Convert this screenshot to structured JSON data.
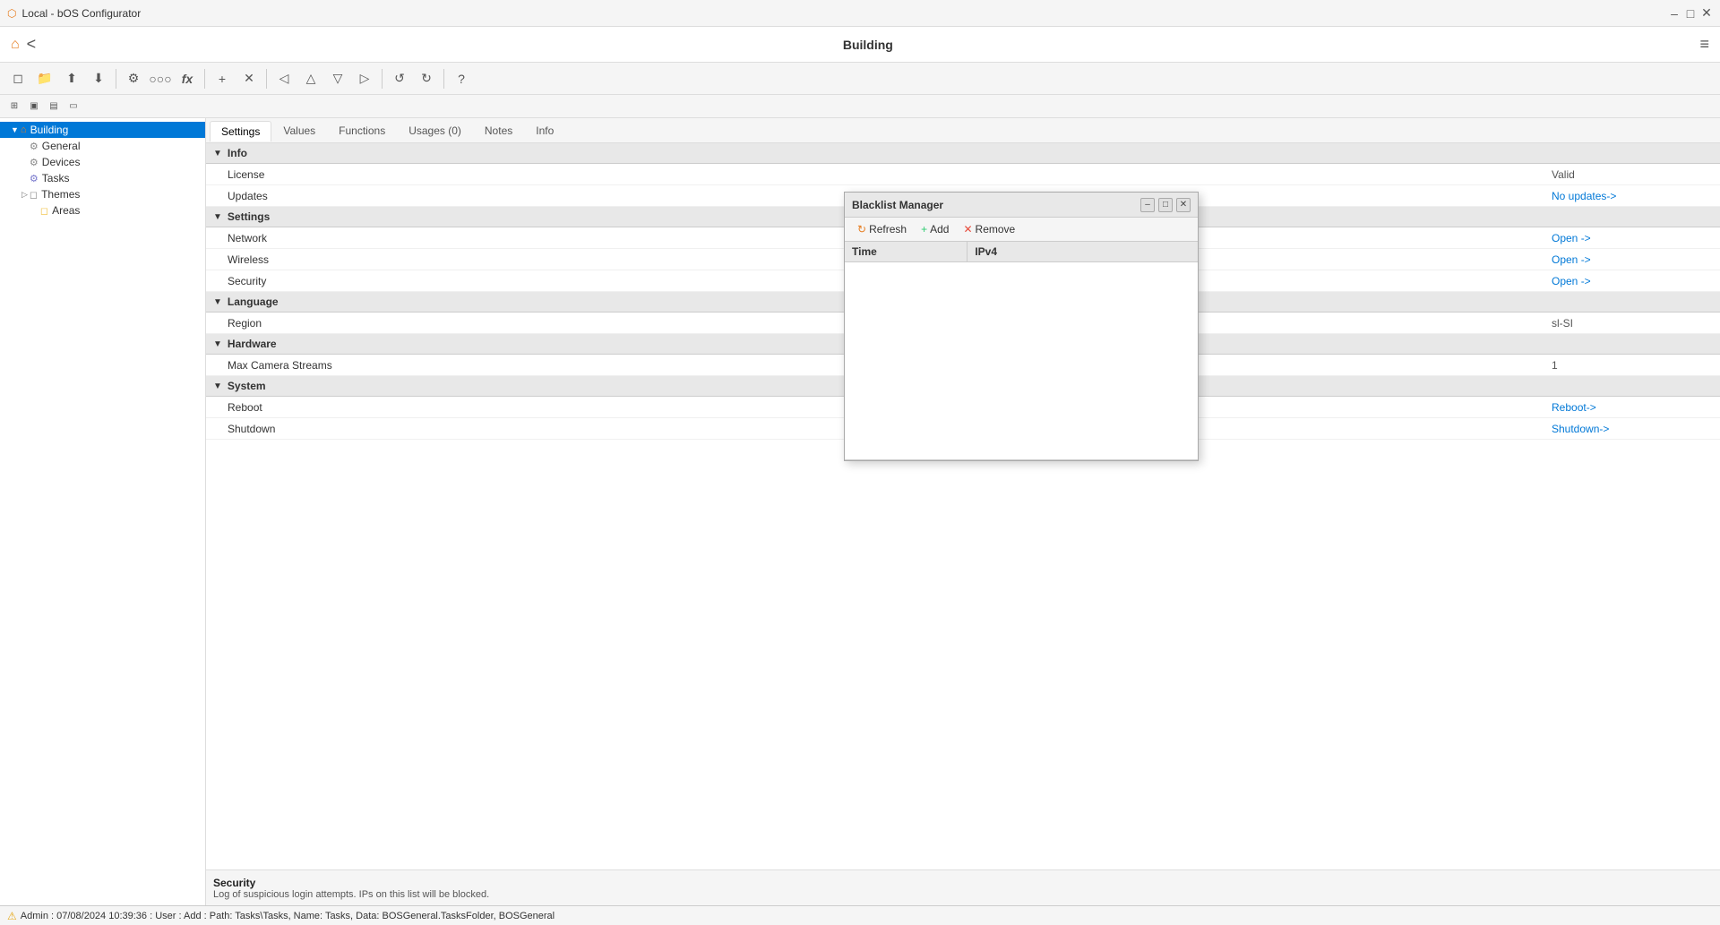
{
  "app": {
    "title": "Local - bOS Configurator",
    "header_title": "Building"
  },
  "titlebar": {
    "title": "Local - bOS Configurator",
    "minimize": "–",
    "maximize": "□",
    "close": "✕"
  },
  "toolbar": {
    "buttons": [
      "🏠",
      "◻",
      "⬆",
      "⬇",
      "⚙",
      "○○○",
      "fx",
      "+",
      "✕",
      "◁",
      "△",
      "▽",
      "▷",
      "↺",
      "↻",
      "?"
    ]
  },
  "sidebar": {
    "items": [
      {
        "id": "building",
        "label": "Building",
        "level": 0,
        "icon": "🏠",
        "selected": true,
        "toggle": "▼"
      },
      {
        "id": "general",
        "label": "General",
        "level": 1,
        "icon": "⚙",
        "selected": false,
        "toggle": ""
      },
      {
        "id": "devices",
        "label": "Devices",
        "level": 1,
        "icon": "⚙",
        "selected": false,
        "toggle": ""
      },
      {
        "id": "tasks",
        "label": "Tasks",
        "level": 1,
        "icon": "⚙",
        "selected": false,
        "toggle": ""
      },
      {
        "id": "themes",
        "label": "Themes",
        "level": 1,
        "icon": "◻",
        "selected": false,
        "toggle": "▷"
      },
      {
        "id": "areas",
        "label": "Areas",
        "level": 2,
        "icon": "◻",
        "selected": false,
        "toggle": ""
      }
    ]
  },
  "tabs": [
    {
      "id": "settings",
      "label": "Settings",
      "active": true
    },
    {
      "id": "values",
      "label": "Values",
      "active": false
    },
    {
      "id": "functions",
      "label": "Functions",
      "active": false
    },
    {
      "id": "usages",
      "label": "Usages (0)",
      "active": false
    },
    {
      "id": "notes",
      "label": "Notes",
      "active": false
    },
    {
      "id": "info",
      "label": "Info",
      "active": false
    }
  ],
  "settings": {
    "sections": [
      {
        "id": "info",
        "label": "Info",
        "expanded": true,
        "rows": [
          {
            "label": "License",
            "value": "Valid",
            "type": "text"
          },
          {
            "label": "Updates",
            "value": "No updates->",
            "type": "link"
          }
        ]
      },
      {
        "id": "settings",
        "label": "Settings",
        "expanded": true,
        "rows": [
          {
            "label": "Network",
            "value": "Open ->",
            "type": "link"
          },
          {
            "label": "Wireless",
            "value": "Open ->",
            "type": "link"
          },
          {
            "label": "Security",
            "value": "Open ->",
            "type": "link"
          }
        ]
      },
      {
        "id": "language",
        "label": "Language",
        "expanded": true,
        "rows": [
          {
            "label": "Region",
            "value": "sl-SI",
            "type": "text"
          }
        ]
      },
      {
        "id": "hardware",
        "label": "Hardware",
        "expanded": true,
        "rows": [
          {
            "label": "Max Camera Streams",
            "value": "1",
            "type": "text"
          }
        ]
      },
      {
        "id": "system",
        "label": "System",
        "expanded": true,
        "rows": [
          {
            "label": "Reboot",
            "value": "Reboot->",
            "type": "link"
          },
          {
            "label": "Shutdown",
            "value": "Shutdown->",
            "type": "link"
          }
        ]
      }
    ]
  },
  "security_footer": {
    "title": "Security",
    "description": "Log of suspicious login attempts. IPs on this list will be blocked."
  },
  "statusbar": {
    "warning_icon": "⚠",
    "message": "Admin : 07/08/2024 10:39:36 : User : Add : Path: Tasks\\Tasks, Name: Tasks, Data: BOSGeneral.TasksFolder, BOSGeneral"
  },
  "blacklist_dialog": {
    "title": "Blacklist Manager",
    "minimize": "–",
    "maximize": "□",
    "close": "✕",
    "toolbar": {
      "refresh_icon": "↻",
      "refresh_label": "Refresh",
      "add_icon": "+",
      "add_label": "Add",
      "remove_icon": "✕",
      "remove_label": "Remove"
    },
    "columns": [
      {
        "id": "time",
        "label": "Time"
      },
      {
        "id": "ipv4",
        "label": "IPv4"
      }
    ],
    "rows": []
  }
}
